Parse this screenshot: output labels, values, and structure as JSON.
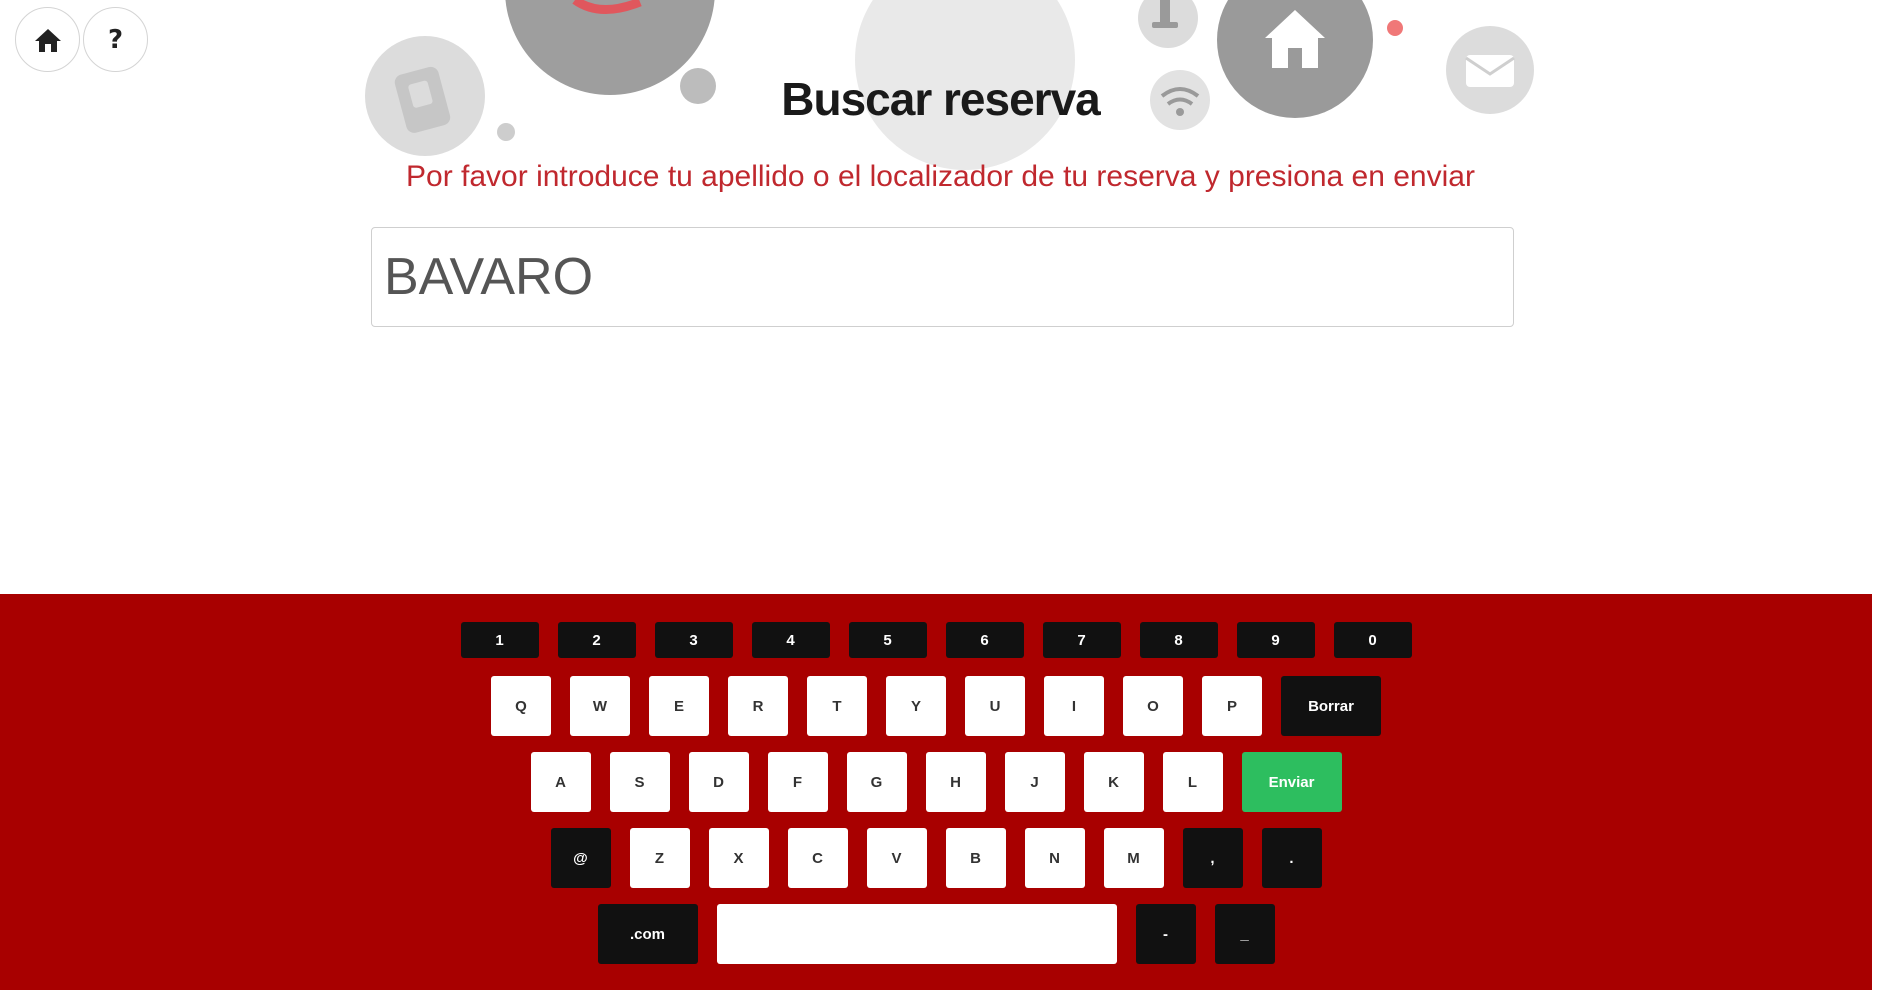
{
  "nav": {
    "home_icon": "home-icon",
    "help_label": "?"
  },
  "header": {
    "title": "Buscar reserva",
    "subtitle": "Por favor introduce tu apellido o el localizador de tu reserva y presiona en enviar"
  },
  "search": {
    "value": "BAVARO"
  },
  "keyboard": {
    "numbers": [
      "1",
      "2",
      "3",
      "4",
      "5",
      "6",
      "7",
      "8",
      "9",
      "0"
    ],
    "row1": [
      "Q",
      "W",
      "E",
      "R",
      "T",
      "Y",
      "U",
      "I",
      "O",
      "P"
    ],
    "backspace_label": "Borrar",
    "row2": [
      "A",
      "S",
      "D",
      "F",
      "G",
      "H",
      "J",
      "K",
      "L"
    ],
    "submit_label": "Enviar",
    "at_label": "@",
    "row3": [
      "Z",
      "X",
      "C",
      "V",
      "B",
      "N",
      "M"
    ],
    "comma_label": ",",
    "period_label": ".",
    "dotcom_label": ".com",
    "hyphen_label": "-",
    "underscore_label": "_"
  },
  "colors": {
    "keyboard_bg": "#a80000",
    "subtitle": "#c0282e",
    "submit": "#2dbe5f"
  }
}
